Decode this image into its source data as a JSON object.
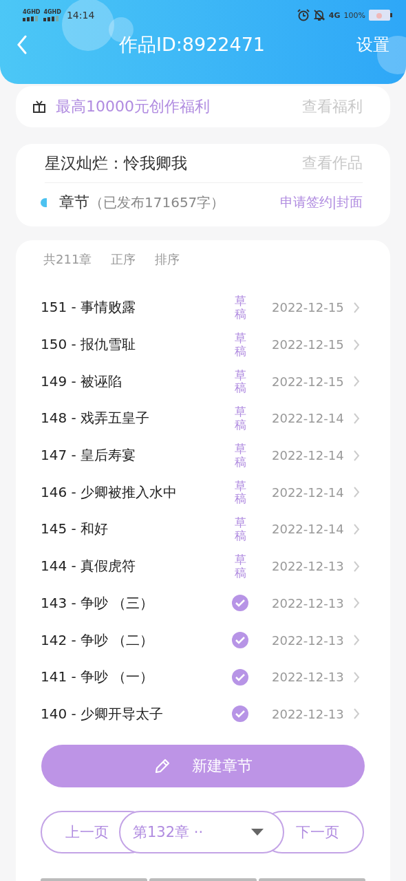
{
  "status_bar": {
    "networks": [
      "4GHD",
      "4GHD"
    ],
    "time": "14:14",
    "mobile": "4G",
    "battery": "100%"
  },
  "header": {
    "title": "作品ID:8922471",
    "action": "设置"
  },
  "welfare": {
    "text": "最高10000元创作福利",
    "link": "查看福利"
  },
  "work": {
    "title": "星汉灿烂：怜我卿我",
    "view": "查看作品",
    "section": "章节",
    "published": "（已发布171657字）",
    "apply": "申请签约|封面"
  },
  "chapters": {
    "count": "共211章",
    "order": "正序",
    "sort": "排序",
    "rows": [
      {
        "title": "151 - 事情败露",
        "kind": "draft",
        "status": "草稿",
        "date": "2022-12-15"
      },
      {
        "title": "150 - 报仇雪耻",
        "kind": "draft",
        "status": "草稿",
        "date": "2022-12-15"
      },
      {
        "title": "149 - 被诬陷",
        "kind": "draft",
        "status": "草稿",
        "date": "2022-12-15"
      },
      {
        "title": "148 - 戏弄五皇子",
        "kind": "draft",
        "status": "草稿",
        "date": "2022-12-14"
      },
      {
        "title": "147 - 皇后寿宴",
        "kind": "draft",
        "status": "草稿",
        "date": "2022-12-14"
      },
      {
        "title": "146 - 少卿被推入水中",
        "kind": "draft",
        "status": "草稿",
        "date": "2022-12-14"
      },
      {
        "title": "145 - 和好",
        "kind": "draft",
        "status": "草稿",
        "date": "2022-12-14"
      },
      {
        "title": "144 - 真假虎符",
        "kind": "draft",
        "status": "草稿",
        "date": "2022-12-13"
      },
      {
        "title": "143 - 争吵 （三）",
        "kind": "published",
        "date": "2022-12-13"
      },
      {
        "title": "142 - 争吵 （二）",
        "kind": "published",
        "date": "2022-12-13"
      },
      {
        "title": "141 - 争吵 （一）",
        "kind": "published",
        "date": "2022-12-13"
      },
      {
        "title": "140 - 少卿开导太子",
        "kind": "published",
        "date": "2022-12-13"
      }
    ]
  },
  "new_chapter": "新建章节",
  "pager": {
    "prev": "上一页",
    "current": "第132章 ··",
    "next": "下一页"
  }
}
